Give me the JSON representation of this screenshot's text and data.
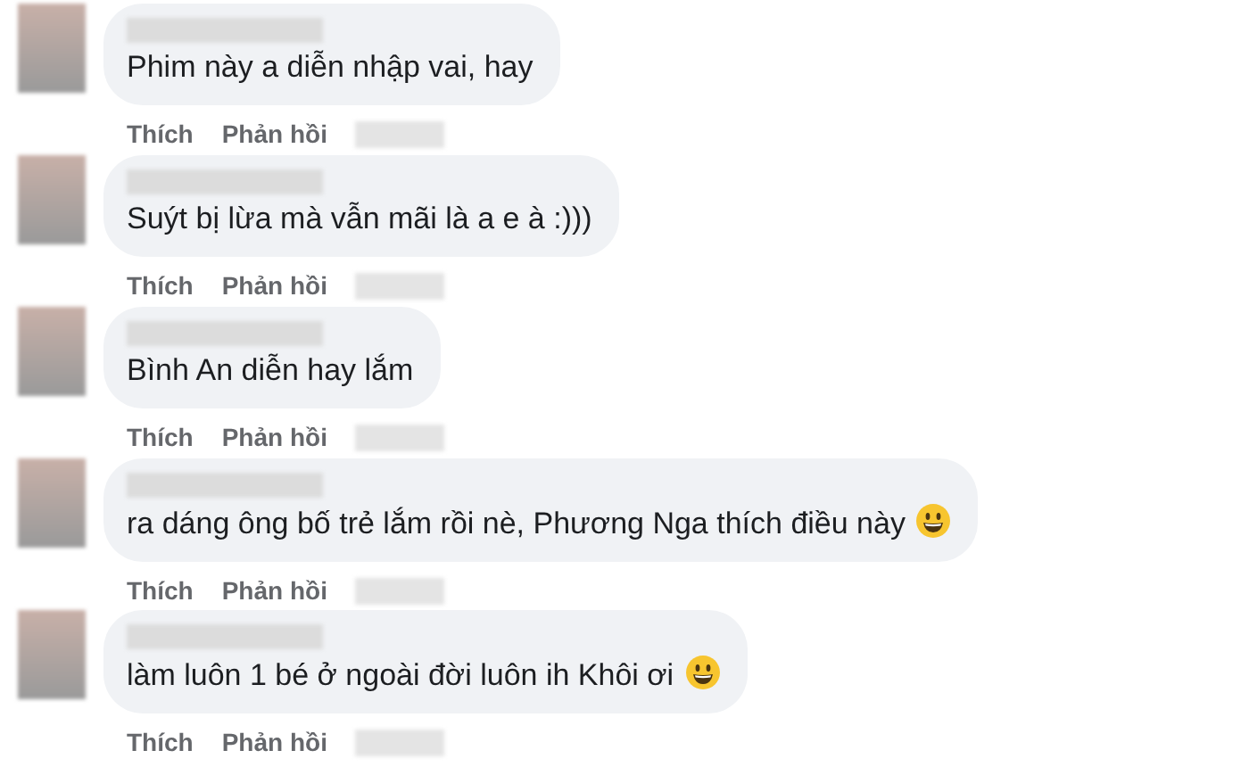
{
  "comments": [
    {
      "text": "Phim này a diễn nhập vai, hay",
      "has_emoji": false,
      "actions": [
        "Thích",
        "Phản hồi"
      ]
    },
    {
      "text": "Suýt bị lừa mà vẫn mãi là a e à :)))",
      "has_emoji": false,
      "actions": [
        "Thích",
        "Phản hồi"
      ]
    },
    {
      "text": "Bình An diễn hay lắm",
      "has_emoji": false,
      "actions": [
        "Thích",
        "Phản hồi"
      ]
    },
    {
      "text": "ra dáng ông bố trẻ lắm rồi nè, Phương Nga thích điều này",
      "has_emoji": true,
      "actions": [
        "Thích",
        "Phản hồi"
      ]
    },
    {
      "text": "làm luôn 1 bé ở ngoài đời luôn ih Khôi ơi",
      "has_emoji": true,
      "actions": [
        "Thích",
        "Phản hồi"
      ]
    }
  ]
}
